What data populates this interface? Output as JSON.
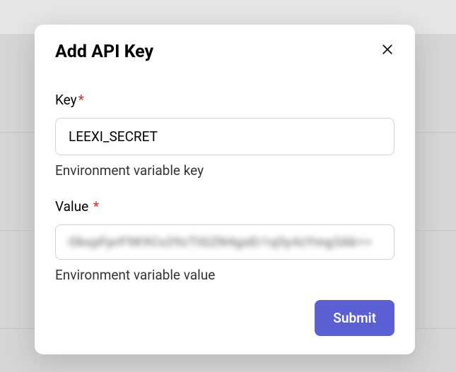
{
  "modal": {
    "title": "Add API Key",
    "key_field": {
      "label": "Key",
      "value": "LEEXI_SECRET",
      "help": "Environment variable key"
    },
    "value_field": {
      "label": "Value",
      "masked_placeholder": "ObspFprF9K9Cs29zTtGZN4gxEr1q5y4zYmg3Ak==",
      "help": "Environment variable value"
    },
    "submit_label": "Submit"
  }
}
